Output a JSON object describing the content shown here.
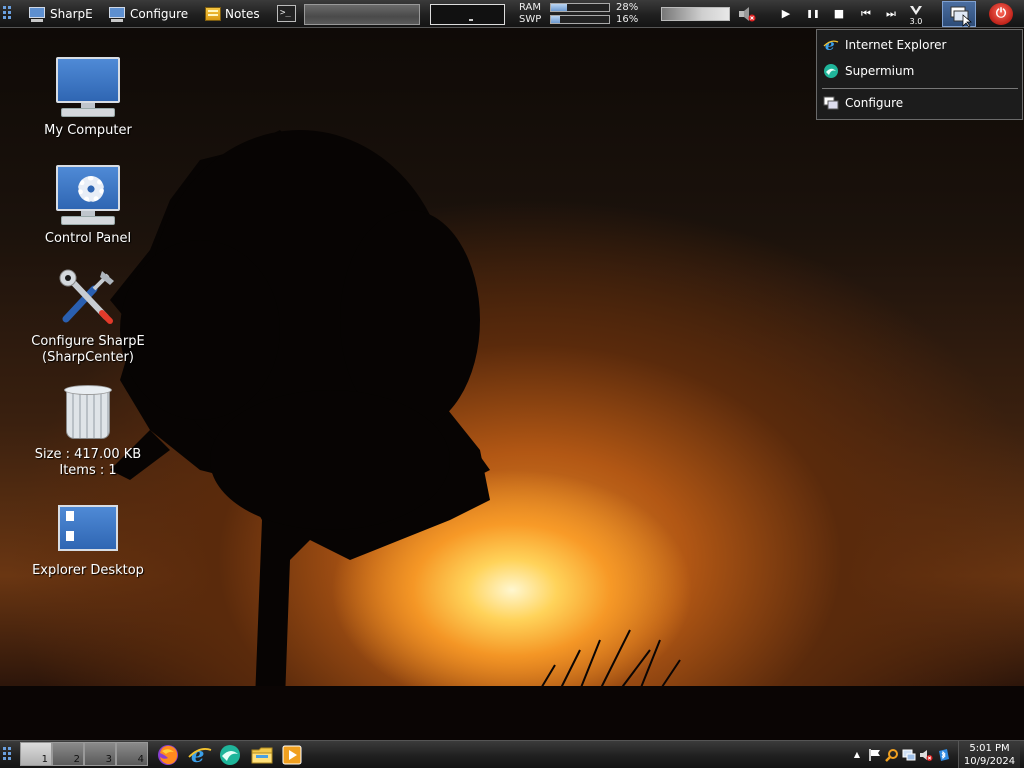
{
  "topbar": {
    "sharpe_label": "SharpE",
    "configure_label": "Configure",
    "notes_label": "Notes",
    "terminal_glyph": ">_",
    "ram_label": "RAM",
    "ram_percent_text": "28%",
    "ram_fraction": 0.28,
    "swp_label": "SWP",
    "swp_percent_text": "16%",
    "swp_fraction": 0.16,
    "media": {
      "play": "▶",
      "pause": "❚❚",
      "stop": "■",
      "prev": "⏮",
      "next": "⏭"
    },
    "winamp_text": "3.0",
    "power_glyph": "⏻"
  },
  "menu": {
    "items": [
      {
        "label": "Internet Explorer",
        "icon": "internet-explorer-icon"
      },
      {
        "label": "Supermium",
        "icon": "supermium-icon"
      },
      {
        "label": "Configure",
        "icon": "configure-icon"
      }
    ]
  },
  "desktop": {
    "icons": [
      {
        "label": "My Computer",
        "icon": "my-computer-icon"
      },
      {
        "label": "Control Panel",
        "icon": "control-panel-icon"
      },
      {
        "label_line1": "Configure SharpE",
        "label_line2": "(SharpCenter)",
        "icon": "tools-icon"
      },
      {
        "label_line1": "Size : 417.00 KB",
        "label_line2": "Items : 1",
        "icon": "recycle-bin-icon"
      },
      {
        "label": "Explorer Desktop",
        "icon": "explorer-desktop-icon"
      }
    ]
  },
  "taskbar": {
    "virtual_desktops": [
      "1",
      "2",
      "3",
      "4"
    ],
    "active_desktop": "1",
    "quick_launch": [
      "firefox-icon",
      "internet-explorer-icon",
      "supermium-icon",
      "file-explorer-icon",
      "media-player-icon"
    ],
    "tray_icons": [
      "show-hidden-icon",
      "flag-icon",
      "search-icon",
      "network-icon",
      "volume-muted-icon",
      "bluetooth-icon"
    ],
    "tray_up_glyph": "▲",
    "clock_time": "5:01 PM",
    "clock_date": "10/9/2024"
  },
  "colors": {
    "accent": "#6aa0e0",
    "power": "#c0231a",
    "bar_fill": "#6d9ad0"
  }
}
